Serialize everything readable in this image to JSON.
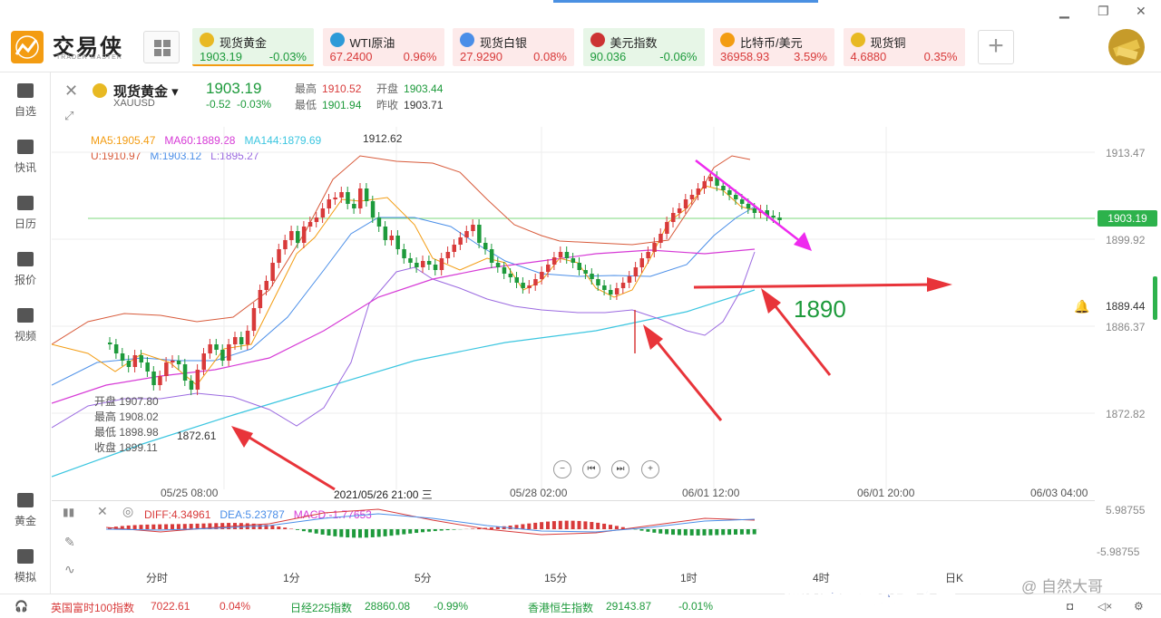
{
  "app": {
    "logo_text": "交易侠",
    "logo_sub": "TRADER MASTER"
  },
  "quotes": [
    {
      "name": "现货黄金",
      "price": "1903.19",
      "change": "-0.03%",
      "dir": "down",
      "icon": "gold-coin-icon",
      "active": true
    },
    {
      "name": "WTI原油",
      "price": "67.2400",
      "change": "0.96%",
      "dir": "up",
      "icon": "oil-icon",
      "active": false
    },
    {
      "name": "现货白银",
      "price": "27.9290",
      "change": "0.08%",
      "dir": "up",
      "icon": "silver-icon",
      "active": false
    },
    {
      "name": "美元指数",
      "price": "90.036",
      "change": "-0.06%",
      "dir": "down",
      "icon": "us-flag-icon",
      "active": false
    },
    {
      "name": "比特币/美元",
      "price": "36958.93",
      "change": "3.59%",
      "dir": "up",
      "icon": "bitcoin-icon",
      "active": false
    },
    {
      "name": "现货铜",
      "price": "4.6880",
      "change": "0.35%",
      "dir": "up",
      "icon": "copper-icon",
      "active": false
    }
  ],
  "sidebar": [
    {
      "label": "自选",
      "icon": "bookmark-icon"
    },
    {
      "label": "快讯",
      "icon": "news-icon"
    },
    {
      "label": "日历",
      "icon": "calendar-icon"
    },
    {
      "label": "报价",
      "icon": "chart-line-icon"
    },
    {
      "label": "视频",
      "icon": "video-icon"
    },
    {
      "label": "黄金",
      "icon": "gold-bar-icon"
    },
    {
      "label": "模拟",
      "icon": "wallet-icon"
    }
  ],
  "symbol": {
    "name": "现货黄金",
    "code": "XAUUSD",
    "price": "1903.19",
    "change": "-0.52",
    "change_pct": "-0.03%",
    "high_label": "最高",
    "high": "1910.52",
    "open_label": "开盘",
    "open": "1903.44",
    "low_label": "最低",
    "low": "1901.94",
    "prev_label": "昨收",
    "prev": "1903.71"
  },
  "indicators": {
    "ma5": "MA5:1905.47",
    "ma60": "MA60:1889.28",
    "ma144": "MA144:1879.69",
    "u": "U:1910.97",
    "m": "M:1903.12",
    "l": "L:1895.27"
  },
  "peak_label": "1912.62",
  "trough_label": "1872.61",
  "ohlc_tooltip": {
    "open": "开盘 1907.80",
    "high": "最高 1908.02",
    "low": "最低 1898.98",
    "close": "收盘 1899.11"
  },
  "price_axis": [
    "1913.47",
    "1899.92",
    "1886.37",
    "1872.82"
  ],
  "current_price": "1903.19",
  "alert_price": "1889.44",
  "annotation_1890": "1890",
  "dates": [
    "05/25 08:00",
    "2021/05/26 21:00 三",
    "05/28 02:00",
    "06/01 12:00",
    "06/01 20:00",
    "06/03 04:00"
  ],
  "macd": {
    "diff": "DIFF:4.34961",
    "dea": "DEA:5.23787",
    "macd": "MACD:-1.77653",
    "axis_top": "5.98755",
    "axis_bottom": "-5.98755"
  },
  "timeframes": [
    "分时",
    "1分",
    "5分",
    "15分",
    "1时",
    "4时",
    "日K"
  ],
  "subtitles": {
    "a": "我等待着那最后孤独",
    "b": "你的柔情我永远不懂"
  },
  "watermark": "@ 自然大哥",
  "ticker": [
    {
      "name": "英国富时100指数",
      "price": "7022.61",
      "change": "0.04%",
      "dir": "up"
    },
    {
      "name": "日经225指数",
      "price": "28860.08",
      "change": "-0.99%",
      "dir": "down"
    },
    {
      "name": "香港恒生指数",
      "price": "29143.87",
      "change": "-0.01%",
      "dir": "down"
    }
  ],
  "colors": {
    "up": "#d83a3a",
    "down": "#1d9a3b",
    "ma5": "#f39c12",
    "ma60": "#d63ad6",
    "ma144": "#3cc6e0",
    "boll_u": "#d85a3a",
    "boll_m": "#4a8ee8",
    "boll_l": "#9b6ae0",
    "arrow": "#e8343a",
    "trend": "#ee2aee"
  }
}
